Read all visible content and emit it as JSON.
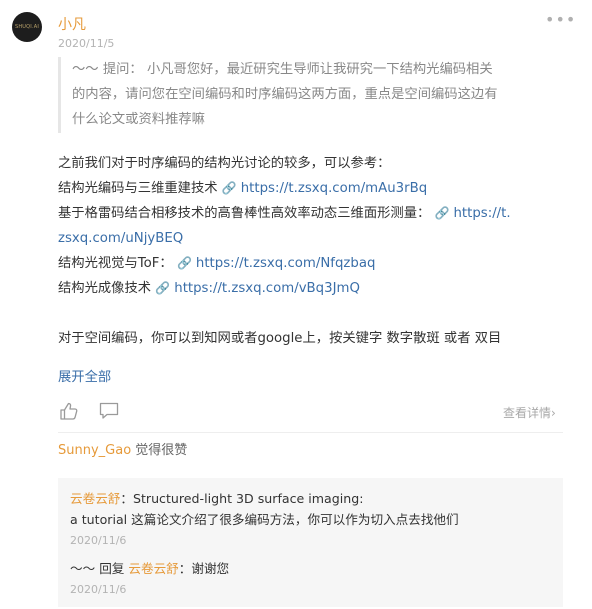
{
  "post": {
    "avatar_text": "SHUQI.AI",
    "author": "小凡",
    "date": "2020/11/5",
    "more_icon": "more-horizontal-icon",
    "quote_lines": [
      "～～ 提问： 小凡哥您好，最近研究生导师让我研究一下结构光编码相关",
      "的内容，请问您在空间编码和时序编码这两方面，重点是空间编码这边有",
      "什么论文或资料推荐嘛"
    ],
    "intro": "之前我们对于时序编码的结构光讨论的较多，可以参考：",
    "refs": [
      {
        "label": "结构光编码与三维重建技术 ",
        "link": "https://t.zsxq.com/mAu3rBq"
      },
      {
        "label": "基于格雷码结合相移技术的高鲁棒性高效率动态三维面形测量： ",
        "link": "https://t.",
        "link_cont": "zsxq.com/uNjyBEQ"
      },
      {
        "label": "结构光视觉与ToF： ",
        "link": "https://t.zsxq.com/Nfqzbaq"
      },
      {
        "label": "结构光成像技术 ",
        "link": "https://t.zsxq.com/vBq3JmQ"
      }
    ],
    "spatial_line": "对于空间编码，你可以到知网或者google上，按关键字 数字散斑 或者 双目",
    "expand_label": "展开全部",
    "detail_label": "查看详情",
    "likers_name": "Sunny_Gao",
    "likers_text": " 觉得很赞"
  },
  "comments": [
    {
      "name": "云卷云舒",
      "text_line1": "：Structured-light 3D surface imaging:",
      "text_line2": "a tutorial  这篇论文介绍了很多编码方法，你可以作为切入点去找他们",
      "date": "2020/11/6"
    },
    {
      "prefix": "～～ 回复 ",
      "name": "云卷云舒",
      "text": "：谢谢您",
      "date": "2020/11/6"
    }
  ]
}
